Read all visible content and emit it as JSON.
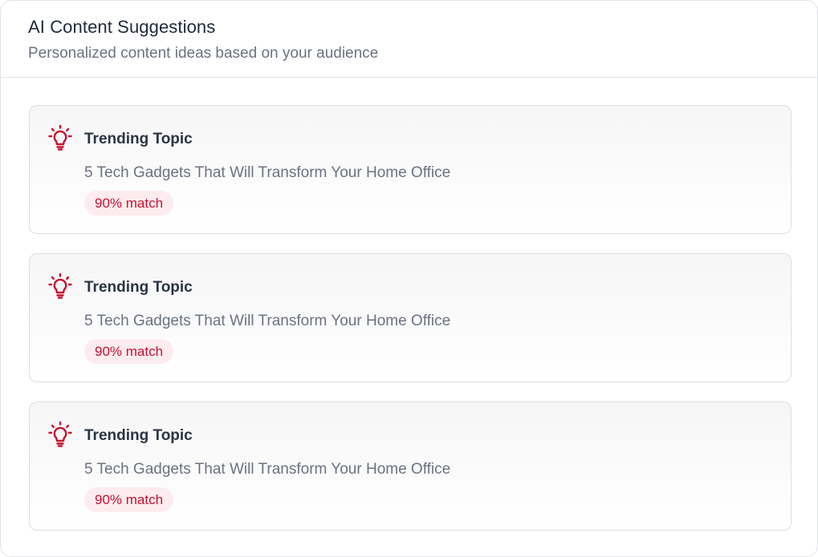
{
  "header": {
    "title": "AI Content Suggestions",
    "subtitle": "Personalized content ideas based on your audience"
  },
  "colors": {
    "accent": "#c8102e",
    "badge_bg": "#fdecef"
  },
  "suggestions": [
    {
      "icon": "lightbulb-icon",
      "label": "Trending Topic",
      "text": "5 Tech Gadgets That Will Transform Your Home Office",
      "match": "90% match"
    },
    {
      "icon": "lightbulb-icon",
      "label": "Trending Topic",
      "text": "5 Tech Gadgets That Will Transform Your Home Office",
      "match": "90% match"
    },
    {
      "icon": "lightbulb-icon",
      "label": "Trending Topic",
      "text": "5 Tech Gadgets That Will Transform Your Home Office",
      "match": "90% match"
    }
  ]
}
